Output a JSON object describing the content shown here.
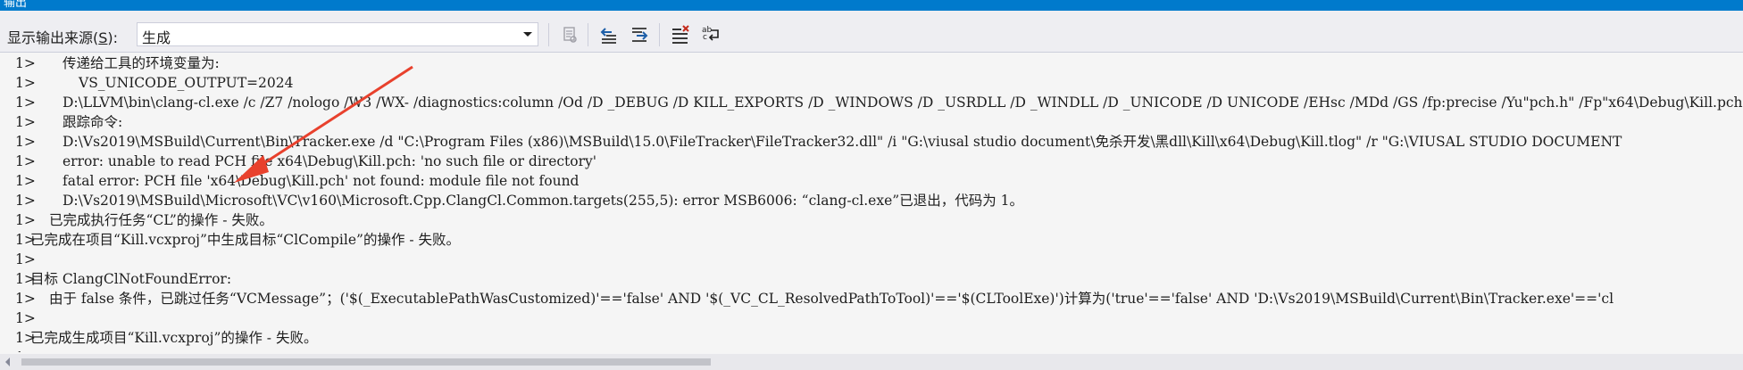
{
  "window": {
    "title": "输出"
  },
  "toolbar": {
    "source_label_pre": "显示输出来源(",
    "source_label_key": "S",
    "source_label_post": "):",
    "source_value": "生成"
  },
  "output": {
    "lines": [
      {
        "prefix": "1>",
        "indent": 1,
        "text": "传递给工具的环境变量为:"
      },
      {
        "prefix": "1>",
        "indent": 2,
        "text": "VS_UNICODE_OUTPUT=2024"
      },
      {
        "prefix": "1>",
        "indent": 1,
        "text": "D:\\LLVM\\bin\\clang-cl.exe /c /Z7 /nologo /W3 /WX- /diagnostics:column /Od /D _DEBUG /D KILL_EXPORTS /D _WINDOWS /D _USRDLL /D _WINDLL /D _UNICODE /D UNICODE /EHsc /MDd /GS /fp:precise /Yu\"pch.h\" /Fp\"x64\\Debug\\Kill.pch\""
      },
      {
        "prefix": "1>",
        "indent": 1,
        "text": "跟踪命令:"
      },
      {
        "prefix": "1>",
        "indent": 1,
        "text": "D:\\Vs2019\\MSBuild\\Current\\Bin\\Tracker.exe /d \"C:\\Program Files (x86)\\MSBuild\\15.0\\FileTracker\\FileTracker32.dll\" /i \"G:\\viusal studio document\\免杀开发\\黑dll\\Kill\\x64\\Debug\\Kill.tlog\" /r \"G:\\VIUSAL STUDIO DOCUMENT"
      },
      {
        "prefix": "1>",
        "indent": 1,
        "text": "error: unable to read PCH file x64\\Debug\\Kill.pch: 'no such file or directory'"
      },
      {
        "prefix": "1>",
        "indent": 1,
        "text": "fatal error: PCH file 'x64\\Debug\\Kill.pch' not found: module file not found"
      },
      {
        "prefix": "1>",
        "indent": 1,
        "text": "D:\\Vs2019\\MSBuild\\Microsoft\\VC\\v160\\Microsoft.Cpp.ClangCl.Common.targets(255,5): error MSB6006: “clang-cl.exe”已退出，代码为 1。"
      },
      {
        "prefix": "1>",
        "indent": 0,
        "text": "已完成执行任务“CL”的操作 - 失败。"
      },
      {
        "prefix": "1>",
        "indent": -1,
        "text": "已完成在项目“Kill.vcxproj”中生成目标“ClCompile”的操作 - 失败。"
      },
      {
        "prefix": "1>",
        "indent": -2,
        "text": ""
      },
      {
        "prefix": "1>",
        "indent": -1,
        "text": "目标 ClangClNotFoundError:"
      },
      {
        "prefix": "1>",
        "indent": 0,
        "text": "由于 false 条件，已跳过任务“VCMessage”；('$(_ExecutablePathWasCustomized)'=='false' AND '$(_VC_CL_ResolvedPathToTool)'=='$(CLToolExe)')计算为('true'=='false' AND 'D:\\Vs2019\\MSBuild\\Current\\Bin\\Tracker.exe'=='cl"
      },
      {
        "prefix": "1>",
        "indent": -2,
        "text": ""
      },
      {
        "prefix": "1>",
        "indent": -1,
        "text": "已完成生成项目“Kill.vcxproj”的操作 - 失败。"
      },
      {
        "prefix": "1>",
        "indent": -2,
        "text": ""
      }
    ]
  },
  "colors": {
    "titlebar": "#007acc",
    "annotation_arrow": "#e8412d",
    "text": "#1e1e1e"
  },
  "icons": {
    "toolbar": [
      "find-message-icon",
      "prev-message-icon",
      "next-message-icon",
      "clear-all-icon",
      "word-wrap-icon"
    ]
  }
}
